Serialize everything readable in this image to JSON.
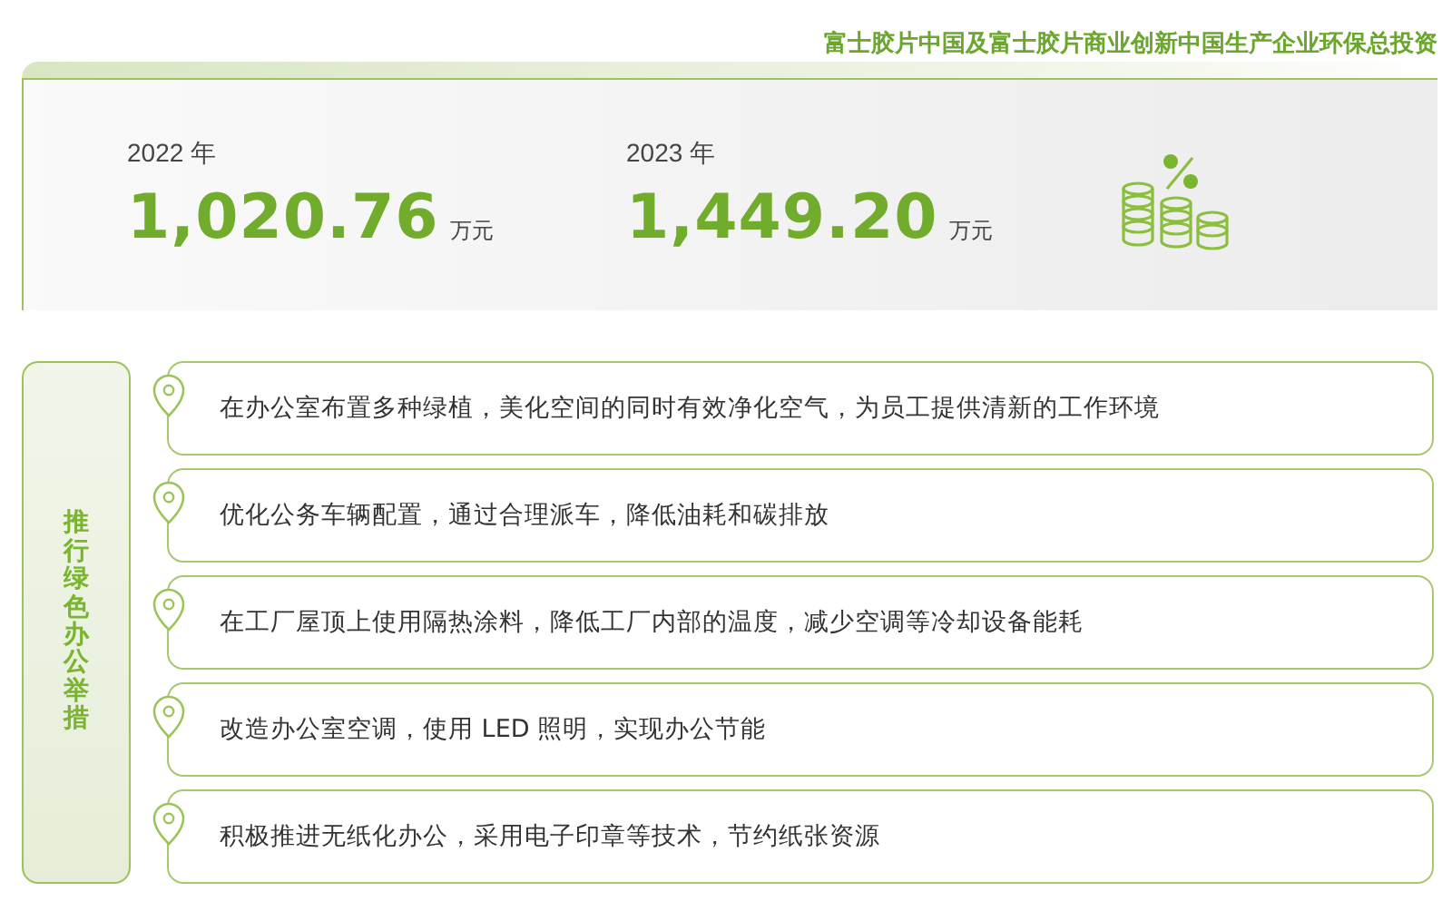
{
  "header": {
    "title": "富士胶片中国及富士胶片商业创新中国生产企业环保总投资"
  },
  "stats": [
    {
      "year": "2022 年",
      "value": "1,020.76",
      "unit": "万元"
    },
    {
      "year": "2023 年",
      "value": "1,449.20",
      "unit": "万元"
    }
  ],
  "measures": {
    "label": "推行绿色办公举措",
    "items": [
      {
        "text": "在办公室布置多种绿植，美化空间的同时有效净化空气，为员工提供清新的工作环境"
      },
      {
        "text": "优化公务车辆配置，通过合理派车，降低油耗和碳排放"
      },
      {
        "text": "在工厂屋顶上使用隔热涂料，降低工厂内部的温度，减少空调等冷却设备能耗"
      },
      {
        "text": "改造办公室空调，使用 LED 照明，实现办公节能"
      },
      {
        "text": "积极推进无纸化办公，采用电子印章等技术，节约纸张资源"
      }
    ]
  }
}
